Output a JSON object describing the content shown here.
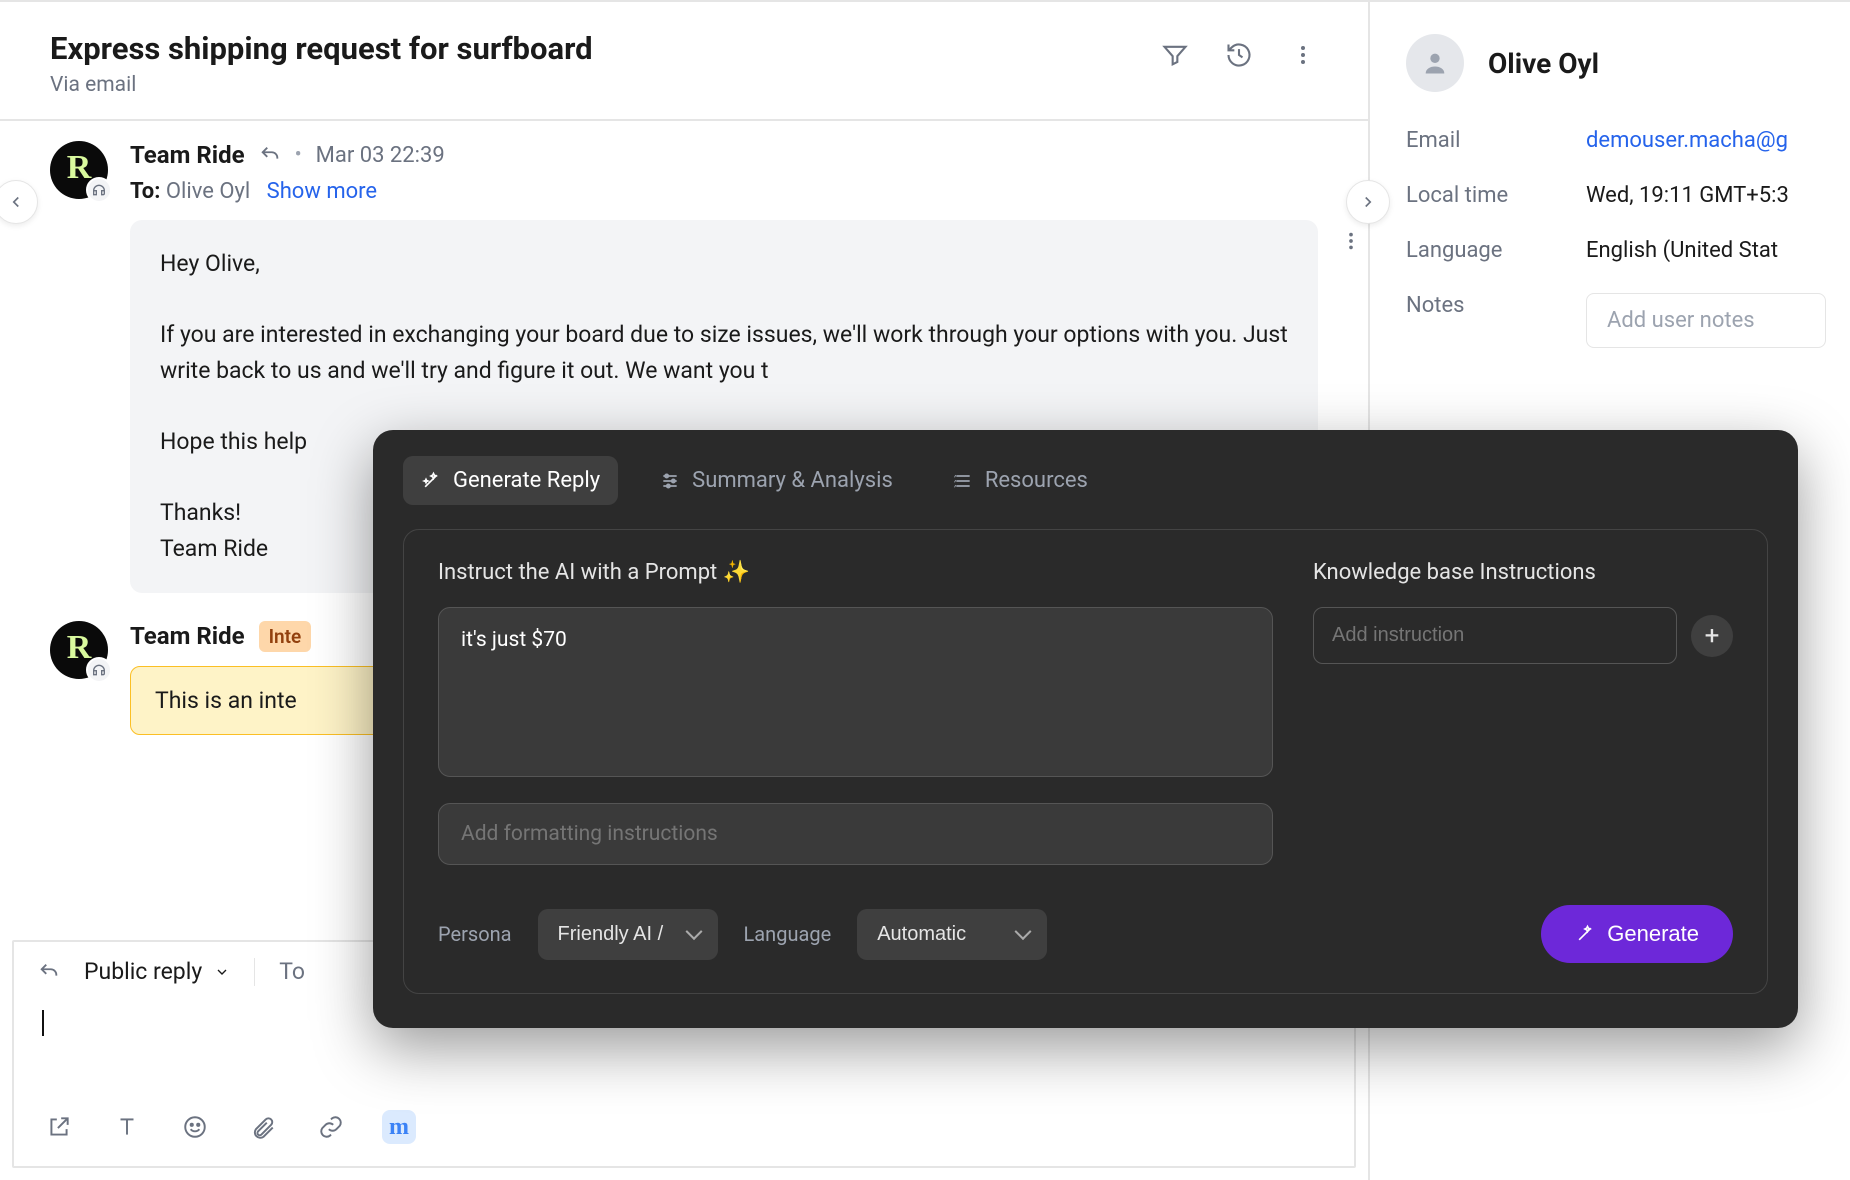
{
  "header": {
    "title": "Express shipping request for surfboard",
    "channel": "Via email"
  },
  "messages": [
    {
      "sender": "Team Ride",
      "timestamp": "Mar 03 22:39",
      "to_label": "To:",
      "to_name": "Olive Oyl",
      "show_more": "Show more",
      "body": "Hey Olive,\n\nIf you are interested in exchanging your board due to size issues, we'll work through your options with you. Just write back to us and we'll try and figure it out. We want you t\n\nHope this help\n\nThanks!\nTeam Ride"
    },
    {
      "sender": "Team Ride",
      "badge": "Inte",
      "body": "This is an inte"
    }
  ],
  "composer": {
    "reply_type": "Public reply",
    "to_label": "To",
    "tools": [
      "external-link",
      "text-format",
      "emoji",
      "attach",
      "link",
      "ai"
    ]
  },
  "profile": {
    "name": "Olive Oyl",
    "fields": {
      "email_label": "Email",
      "email_value": "demouser.macha@g",
      "localtime_label": "Local time",
      "localtime_value": "Wed, 19:11 GMT+5:3",
      "language_label": "Language",
      "language_value": "English (United Stat",
      "notes_label": "Notes",
      "notes_placeholder": "Add user notes"
    }
  },
  "ai_panel": {
    "tabs": {
      "generate": "Generate Reply",
      "summary": "Summary & Analysis",
      "resources": "Resources"
    },
    "prompt_label": "Instruct the AI with a Prompt ✨",
    "prompt_value": "it's just $70",
    "format_placeholder": "Add formatting instructions",
    "kb_label": "Knowledge base Instructions",
    "kb_placeholder": "Add instruction",
    "persona_label": "Persona",
    "persona_value": "Friendly AI /",
    "language_label": "Language",
    "language_value": "Automatic",
    "generate_label": "Generate"
  }
}
